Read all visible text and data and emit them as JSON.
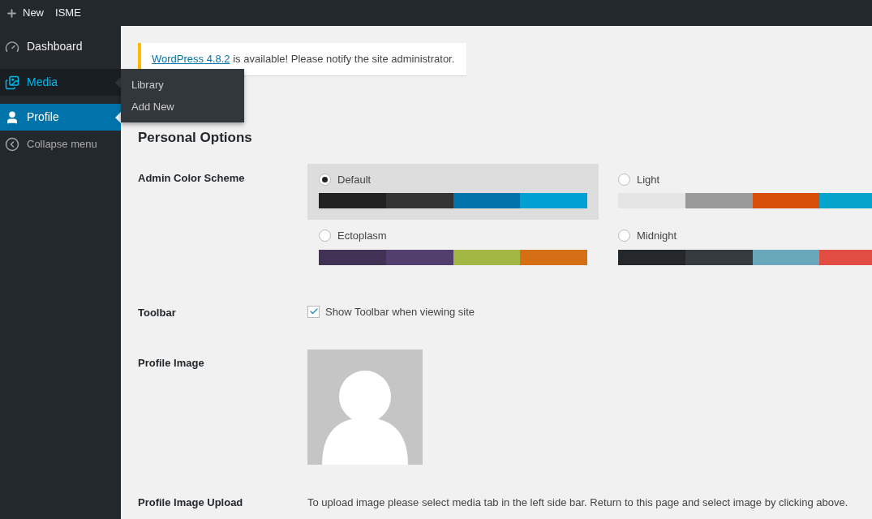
{
  "toolbar": {
    "items": [
      {
        "kind": "new",
        "label": "New"
      },
      {
        "kind": "site",
        "label": "ISME"
      }
    ]
  },
  "sidebar": {
    "items": [
      {
        "kind": "dashboard",
        "label": "Dashboard",
        "selected": false,
        "expanded": false
      },
      {
        "kind": "media",
        "label": "Media",
        "selected": false,
        "expanded": true,
        "children": [
          {
            "label": "Library"
          },
          {
            "label": "Add New"
          }
        ]
      },
      {
        "kind": "profile",
        "label": "Profile",
        "selected": true,
        "expanded": false
      },
      {
        "kind": "collapse",
        "label": "Collapse menu",
        "selected": false,
        "expanded": false
      }
    ]
  },
  "notice": {
    "link": "WordPress 4.8.2",
    "text": " is available! Please notify the site administrator."
  },
  "heading": "Personal Options",
  "color_scheme": {
    "label": "Admin Color Scheme",
    "options": [
      {
        "name": "Default",
        "selected": true,
        "swatches": [
          {
            "color": "#222222"
          },
          {
            "color": "#333333"
          },
          {
            "color": "#0073aa"
          },
          {
            "color": "#00a0d2"
          }
        ]
      },
      {
        "name": "Light",
        "selected": false,
        "swatches": [
          {
            "color": "#e5e5e5"
          },
          {
            "color": "#999999"
          },
          {
            "color": "#d64e07"
          },
          {
            "color": "#04a4cc"
          }
        ]
      },
      {
        "name": "Ectoplasm",
        "selected": false,
        "swatches": [
          {
            "color": "#413256"
          },
          {
            "color": "#523f6d"
          },
          {
            "color": "#a3b745"
          },
          {
            "color": "#d46f15"
          }
        ]
      },
      {
        "name": "Midnight",
        "selected": false,
        "swatches": [
          {
            "color": "#25282b"
          },
          {
            "color": "#363b3f"
          },
          {
            "color": "#69a8bb"
          },
          {
            "color": "#e14d43"
          }
        ]
      }
    ]
  },
  "toolbar_option": {
    "label": "Toolbar",
    "checkbox": "Show Toolbar when viewing site",
    "checked": true
  },
  "profile_image": {
    "label": "Profile Image"
  },
  "profile_upload": {
    "label": "Profile Image Upload",
    "text": "To upload image please select media tab in the left side bar. Return to this page and select image by clicking above."
  }
}
